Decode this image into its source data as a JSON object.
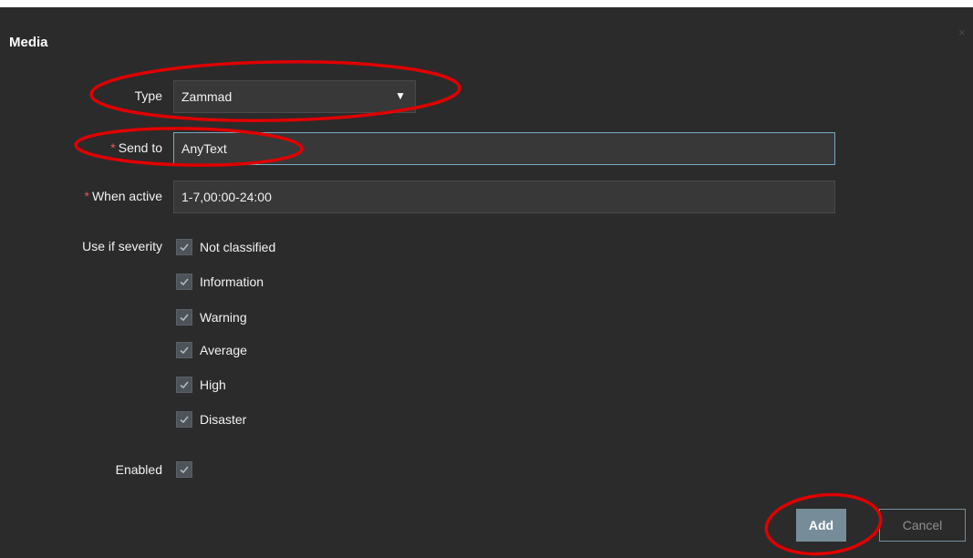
{
  "dialog": {
    "title": "Media",
    "close_label": "×"
  },
  "form": {
    "type": {
      "label": "Type",
      "value": "Zammad",
      "arrow": "▼"
    },
    "send_to": {
      "label": "Send to",
      "required_mark": "*",
      "value": "AnyText"
    },
    "when_active": {
      "label": "When active",
      "required_mark": "*",
      "value": "1-7,00:00-24:00"
    },
    "severity": {
      "label": "Use if severity",
      "options": [
        {
          "label": "Not classified",
          "checked": true
        },
        {
          "label": "Information",
          "checked": true
        },
        {
          "label": "Warning",
          "checked": true
        },
        {
          "label": "Average",
          "checked": true
        },
        {
          "label": "High",
          "checked": true
        },
        {
          "label": "Disaster",
          "checked": true
        }
      ]
    },
    "enabled": {
      "label": "Enabled",
      "checked": true
    }
  },
  "buttons": {
    "add": "Add",
    "cancel": "Cancel"
  },
  "colors": {
    "background": "#2b2b2b",
    "input_background": "#383838",
    "primary_button": "#768d99",
    "required_mark": "#e45959",
    "annotation_red": "#e00000"
  },
  "icons": {
    "checkmark": "check-icon",
    "dropdown": "triangle-down-icon",
    "close": "close-icon"
  }
}
